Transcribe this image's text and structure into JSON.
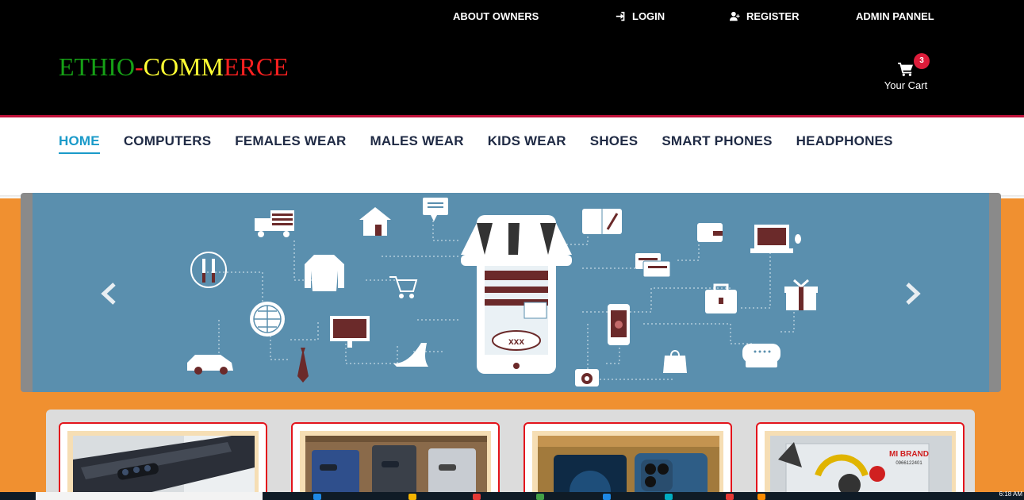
{
  "header": {
    "links": [
      {
        "label": "ABOUT OWNERS",
        "icon": ""
      },
      {
        "label": "LOGIN",
        "icon": "login-icon"
      },
      {
        "label": "REGISTER",
        "icon": "add-user-icon"
      },
      {
        "label": "ADMIN PANNEL",
        "icon": ""
      }
    ],
    "logo": {
      "part1": "ETHIO",
      "dash": "-",
      "part2": "COMM",
      "part3": "ERCE"
    },
    "cart": {
      "label": "Your Cart",
      "count": "3",
      "icon": "cart-icon"
    }
  },
  "nav": {
    "items": [
      {
        "label": "HOME",
        "active": true
      },
      {
        "label": "COMPUTERS"
      },
      {
        "label": "FEMALES WEAR"
      },
      {
        "label": "MALES WEAR"
      },
      {
        "label": "KIDS WEAR"
      },
      {
        "label": "SHOES"
      },
      {
        "label": "SMART PHONES"
      },
      {
        "label": "HEADPHONES"
      }
    ]
  },
  "carousel": {
    "prev_icon": "chevron-left-icon",
    "next_icon": "chevron-right-icon",
    "slide_text": "xxx"
  },
  "products": [
    {
      "name": "product-samsung-galaxy"
    },
    {
      "name": "product-galaxy-note"
    },
    {
      "name": "product-iphone"
    },
    {
      "name": "product-headphones-box",
      "brand_text": "MI BRAND",
      "phone": "0966122401"
    }
  ],
  "taskbar": {
    "clock": "6:18 AM"
  },
  "colors": {
    "header_bg": "#000000",
    "accent_red": "#c1123a",
    "nav_active": "#1a9ac9",
    "nav_text": "#1f2a44",
    "orange_bg": "#f09030",
    "slide_bg": "#5a8fae",
    "card_border": "#e3141c",
    "logo_green": "#16a016",
    "logo_yellow": "#ffff33",
    "logo_red": "#ff2020"
  }
}
